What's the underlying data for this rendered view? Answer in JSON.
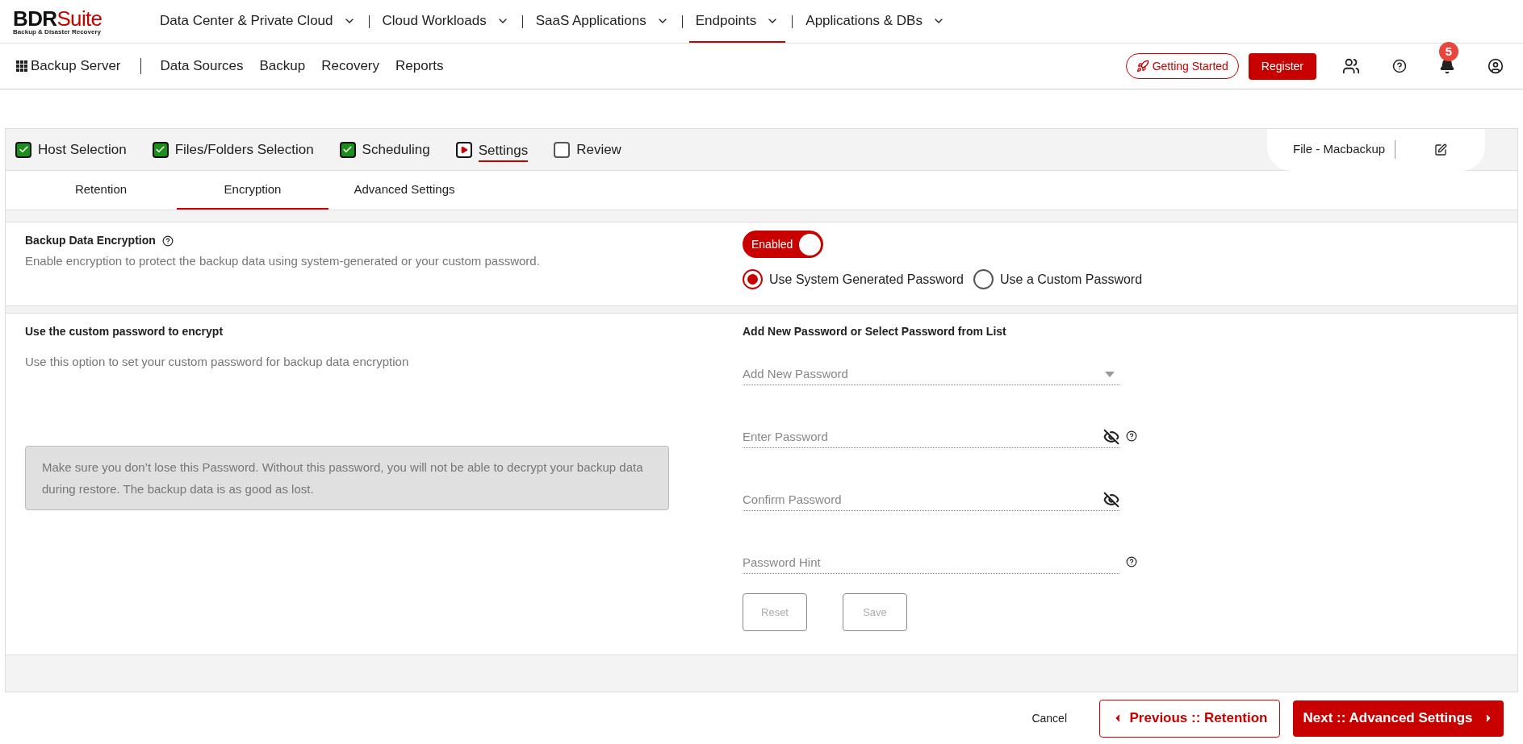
{
  "brand": {
    "name_dark": "BDR",
    "name_red": "Suite",
    "tagline": "Backup & Disaster Recovery"
  },
  "top_menu": [
    {
      "label": "Data Center & Private Cloud",
      "selected": false
    },
    {
      "label": "Cloud Workloads",
      "selected": false
    },
    {
      "label": "SaaS Applications",
      "selected": false
    },
    {
      "label": "Endpoints",
      "selected": true
    },
    {
      "label": "Applications & DBs",
      "selected": false
    }
  ],
  "sub_nav": {
    "title": "Backup Server",
    "items": [
      "Data Sources",
      "Backup",
      "Recovery",
      "Reports"
    ],
    "getting_started": "Getting Started",
    "register": "Register",
    "notifications": "5"
  },
  "steps": [
    {
      "label": "Host Selection",
      "kind": "done"
    },
    {
      "label": "Files/Folders Selection",
      "kind": "done"
    },
    {
      "label": "Scheduling",
      "kind": "done"
    },
    {
      "label": "Settings",
      "kind": "current"
    },
    {
      "label": "Review",
      "kind": "pending"
    }
  ],
  "job_name": "File - Macbackup",
  "tabs": [
    {
      "label": "Retention",
      "selected": false
    },
    {
      "label": "Encryption",
      "selected": true
    },
    {
      "label": "Advanced Settings",
      "selected": false
    }
  ],
  "encryption": {
    "title": "Backup Data Encryption",
    "description": "Enable encryption to protect the backup data using system-generated or your custom password.",
    "toggle": {
      "label": "Enabled",
      "on": true
    },
    "options": [
      {
        "label": "Use System Generated Password",
        "selected": true
      },
      {
        "label": "Use a Custom Password",
        "selected": false
      }
    ]
  },
  "custom": {
    "title": "Use the custom password to encrypt",
    "description": "Use this option to set your custom password for backup data encryption",
    "warning": "Make sure you don’t lose this Password. Without this password, you will not be able to decrypt your backup data during restore. The backup data is as good as lost."
  },
  "password_form": {
    "title": "Add New Password or Select Password from List",
    "fields": [
      {
        "kind": "select",
        "placeholder": "Add New Password",
        "eye": false,
        "help": false
      },
      {
        "kind": "password",
        "placeholder": "Enter Password",
        "eye": true,
        "help": true
      },
      {
        "kind": "password",
        "placeholder": "Confirm Password",
        "eye": true,
        "help": false
      },
      {
        "kind": "text",
        "placeholder": "Password Hint",
        "eye": false,
        "help": true
      }
    ],
    "buttons": [
      {
        "label": "Reset",
        "disabled": true
      },
      {
        "label": "Save",
        "disabled": true
      }
    ]
  },
  "footer": {
    "cancel": "Cancel",
    "previous": "Previous :: Retention",
    "next": "Next :: Advanced Settings"
  }
}
